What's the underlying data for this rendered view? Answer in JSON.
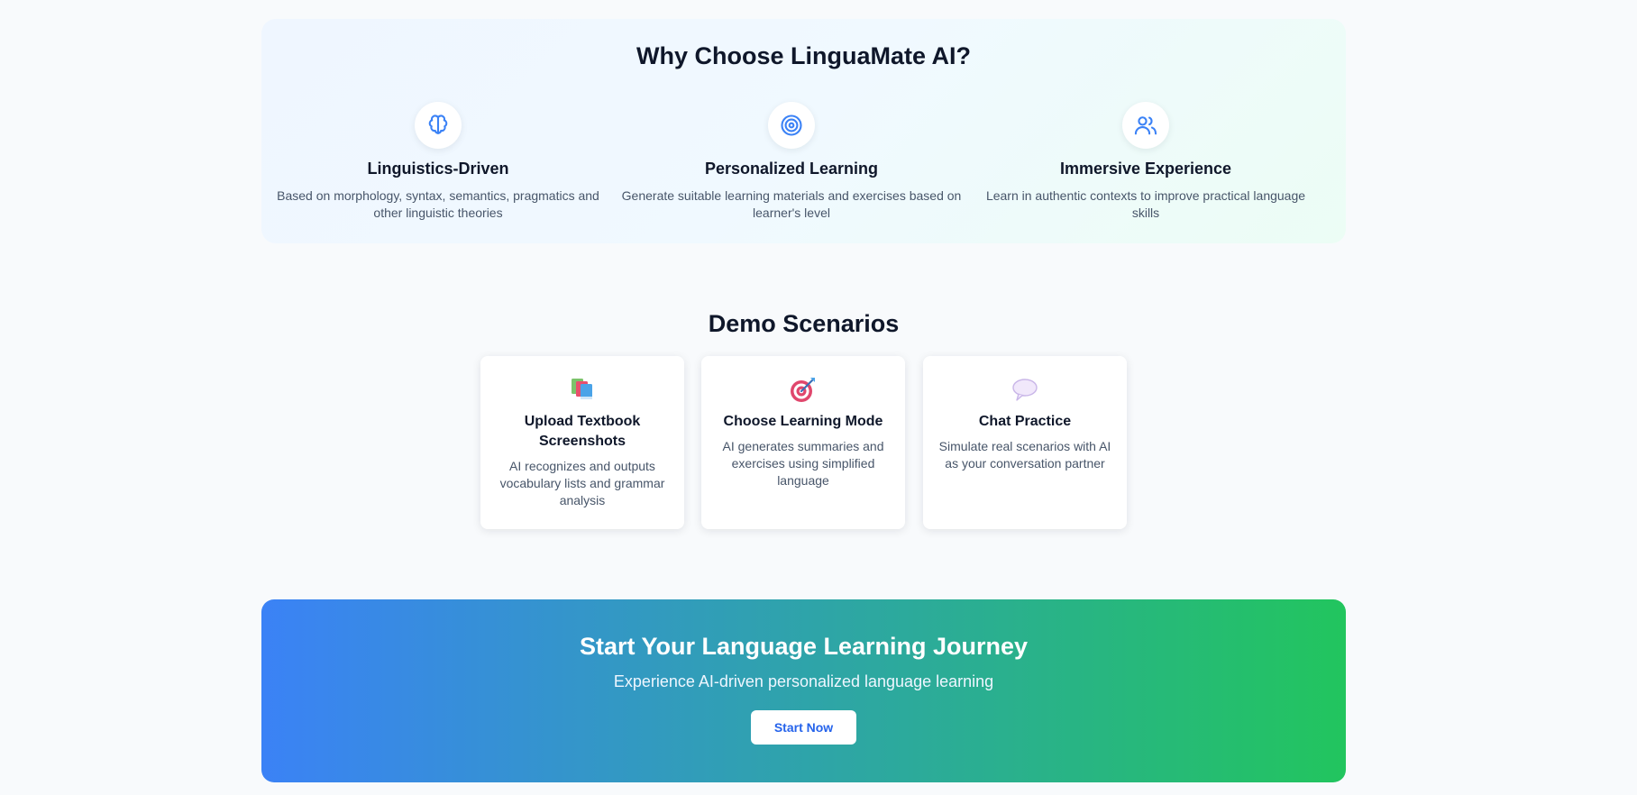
{
  "why": {
    "title": "Why Choose LinguaMate AI?",
    "features": [
      {
        "icon": "brain-icon",
        "title": "Linguistics-Driven",
        "description": "Based on morphology, syntax, semantics, pragmatics and other linguistic theories"
      },
      {
        "icon": "target-icon",
        "title": "Personalized Learning",
        "description": "Generate suitable learning materials and exercises based on learner's level"
      },
      {
        "icon": "users-icon",
        "title": "Immersive Experience",
        "description": "Learn in authentic contexts to improve practical language skills"
      }
    ]
  },
  "demo": {
    "title": "Demo Scenarios",
    "cards": [
      {
        "icon": "books-emoji-icon",
        "title": "Upload Textbook Screenshots",
        "description": "AI recognizes and outputs vocabulary lists and grammar analysis"
      },
      {
        "icon": "dart-target-emoji-icon",
        "title": "Choose Learning Mode",
        "description": "AI generates summaries and exercises using simplified language"
      },
      {
        "icon": "speech-bubble-emoji-icon",
        "title": "Chat Practice",
        "description": "Simulate real scenarios with AI as your conversation partner"
      }
    ]
  },
  "cta": {
    "title": "Start Your Language Learning Journey",
    "subtitle": "Experience AI-driven personalized language learning",
    "button_label": "Start Now"
  },
  "colors": {
    "accent_blue": "#3b82f6",
    "accent_green": "#22c55e",
    "heading": "#0f172a",
    "body_text": "#475569"
  }
}
